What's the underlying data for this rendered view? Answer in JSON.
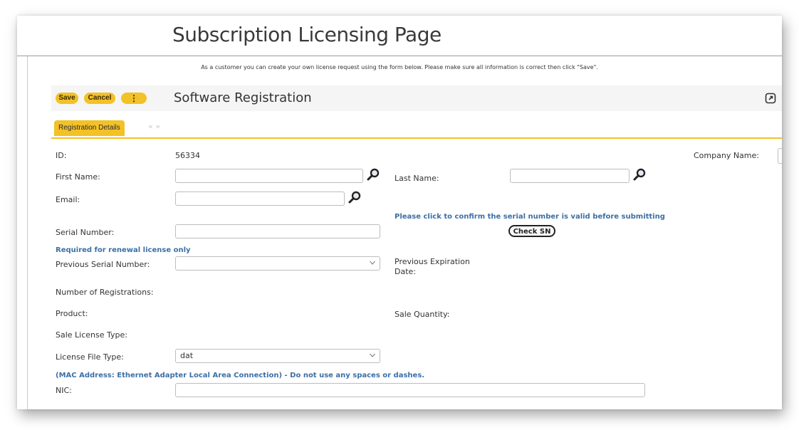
{
  "page": {
    "title": "Subscription Licensing Page",
    "instructions": "As a customer you can create your own license request using the form below. Please make sure all information is correct then click \"Save\"."
  },
  "toolbar": {
    "save_label": "Save",
    "cancel_label": "Cancel",
    "more_label": "⋮",
    "form_title": "Software Registration",
    "popout_icon": "popout-icon"
  },
  "tabs": {
    "active": "Registration Details",
    "nav": "« »"
  },
  "form": {
    "id_label": "ID:",
    "id_value": "56334",
    "company_label": "Company Name:",
    "first_name_label": "First Name:",
    "first_name_value": "",
    "last_name_label": "Last Name:",
    "last_name_value": "",
    "email_label": "Email:",
    "email_value": "",
    "serial_note": "Please click to confirm the serial number is valid before submitting",
    "serial_label": "Serial Number:",
    "serial_value": "",
    "check_sn_label": "Check SN",
    "renewal_note": "Required for renewal license only",
    "prev_serial_label": "Previous Serial Number:",
    "prev_serial_value": "",
    "prev_exp_label_1": "Previous Expiration",
    "prev_exp_label_2": "Date:",
    "num_reg_label": "Number of Registrations:",
    "product_label": "Product:",
    "sale_qty_label": "Sale Quantity:",
    "sale_license_label": "Sale License Type:",
    "license_file_label": "License File Type:",
    "license_file_value": "dat",
    "mac_note": "(MAC Address: Ethernet Adapter Local Area Connection) - Do not use any spaces or dashes.",
    "nic_label": "NIC:",
    "nic_value": ""
  },
  "colors": {
    "accent": "#f3c128",
    "note_blue": "#3c6fa6"
  }
}
